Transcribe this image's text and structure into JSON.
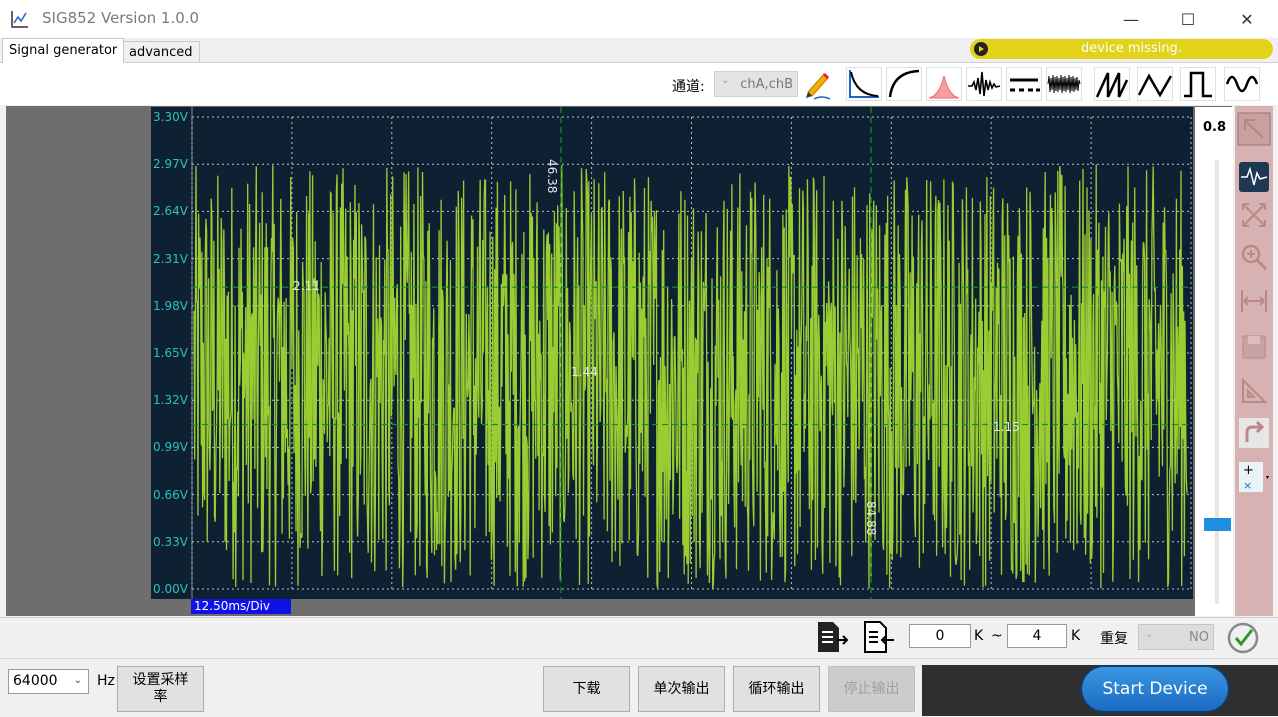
{
  "window": {
    "title": "SIG852  Version 1.0.0",
    "minimize": "—",
    "maximize": "☐",
    "close": "✕"
  },
  "tabs": [
    {
      "label": "Signal generator",
      "active": true
    },
    {
      "label": "advanced",
      "active": false
    }
  ],
  "device_status": {
    "text": "device  missing.",
    "color": "#e2d21a"
  },
  "toolbar": {
    "channel_label": "通道:",
    "channel_value": "chA,chB",
    "waveform_icons": [
      "pen-edit-icon",
      "decay-curve-icon",
      "rise-curve-icon",
      "gaussian-icon",
      "spike-noise-icon",
      "dc-level-icon",
      "noise-icon",
      "sawtooth-icon",
      "triangle-icon",
      "square-icon",
      "sine-icon"
    ]
  },
  "scope": {
    "y_ticks": [
      "3.30V",
      "2.97V",
      "2.64V",
      "2.31V",
      "1.98V",
      "1.65V",
      "1.32V",
      "0.99V",
      "0.66V",
      "0.33V",
      "0.00V"
    ],
    "timebase": "12.50ms/Div",
    "signal_color": "#9acd32",
    "cursor_labels": {
      "v_cursor_1": "46.38",
      "v_cursor_2": "84.88",
      "h_cursor_1": "2.11",
      "h_cursor_2": "1.15",
      "center_readout": "1.44"
    }
  },
  "right_panel": {
    "scale_value": "0.8",
    "scale_level_fraction": 0.18
  },
  "range_row": {
    "from_value": "0",
    "from_unit": "K",
    "sep": "~",
    "to_value": "4",
    "to_unit": "K",
    "repeat_label": "重复",
    "repeat_value": "NO"
  },
  "bottom": {
    "rate_value": "64000",
    "rate_unit": "Hz",
    "set_rate_button": "设置采样率",
    "download_button": "下载",
    "single_button": "单次输出",
    "loop_button": "循环输出",
    "stop_button": "停止输出",
    "start_button": "Start Device"
  }
}
